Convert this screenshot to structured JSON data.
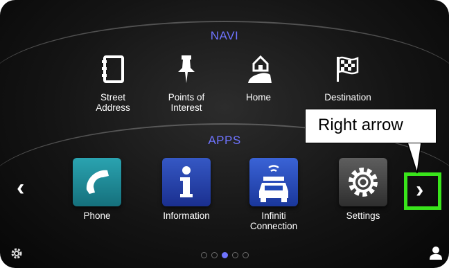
{
  "navi": {
    "title": "NAVI",
    "items": [
      {
        "label": "Street\nAddress",
        "icon": "address-book-icon"
      },
      {
        "label": "Points of\nInterest",
        "icon": "pushpin-icon"
      },
      {
        "label": "Home",
        "icon": "home-icon"
      },
      {
        "label": "Destination",
        "icon": "checkered-flag-icon"
      }
    ]
  },
  "apps": {
    "title": "APPS",
    "items": [
      {
        "label": "Phone",
        "icon": "phone-icon",
        "color": "#1d8a97"
      },
      {
        "label": "Information",
        "icon": "info-icon",
        "color": "#1f3fa8"
      },
      {
        "label": "Infiniti\nConnection",
        "icon": "connected-car-icon",
        "color": "#2149b8"
      },
      {
        "label": "Settings",
        "icon": "gear-icon",
        "color": "#4a4a4a"
      }
    ]
  },
  "nav_arrows": {
    "left": "‹",
    "right": "›"
  },
  "callout": {
    "text": "Right arrow"
  },
  "pagination": {
    "total": 5,
    "active_index": 2
  },
  "colors": {
    "accent": "#6f74ff",
    "highlight": "#39e51b"
  }
}
